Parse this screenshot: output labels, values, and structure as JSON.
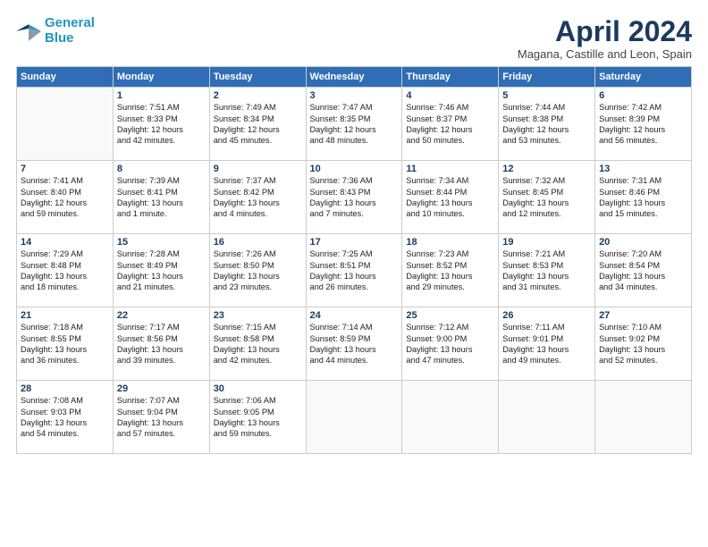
{
  "header": {
    "logo_line1": "General",
    "logo_line2": "Blue",
    "month": "April 2024",
    "location": "Magana, Castille and Leon, Spain"
  },
  "days_of_week": [
    "Sunday",
    "Monday",
    "Tuesday",
    "Wednesday",
    "Thursday",
    "Friday",
    "Saturday"
  ],
  "weeks": [
    [
      {
        "day": "",
        "sunrise": "",
        "sunset": "",
        "daylight": ""
      },
      {
        "day": "1",
        "sunrise": "Sunrise: 7:51 AM",
        "sunset": "Sunset: 8:33 PM",
        "daylight": "Daylight: 12 hours and 42 minutes."
      },
      {
        "day": "2",
        "sunrise": "Sunrise: 7:49 AM",
        "sunset": "Sunset: 8:34 PM",
        "daylight": "Daylight: 12 hours and 45 minutes."
      },
      {
        "day": "3",
        "sunrise": "Sunrise: 7:47 AM",
        "sunset": "Sunset: 8:35 PM",
        "daylight": "Daylight: 12 hours and 48 minutes."
      },
      {
        "day": "4",
        "sunrise": "Sunrise: 7:46 AM",
        "sunset": "Sunset: 8:37 PM",
        "daylight": "Daylight: 12 hours and 50 minutes."
      },
      {
        "day": "5",
        "sunrise": "Sunrise: 7:44 AM",
        "sunset": "Sunset: 8:38 PM",
        "daylight": "Daylight: 12 hours and 53 minutes."
      },
      {
        "day": "6",
        "sunrise": "Sunrise: 7:42 AM",
        "sunset": "Sunset: 8:39 PM",
        "daylight": "Daylight: 12 hours and 56 minutes."
      }
    ],
    [
      {
        "day": "7",
        "sunrise": "Sunrise: 7:41 AM",
        "sunset": "Sunset: 8:40 PM",
        "daylight": "Daylight: 12 hours and 59 minutes."
      },
      {
        "day": "8",
        "sunrise": "Sunrise: 7:39 AM",
        "sunset": "Sunset: 8:41 PM",
        "daylight": "Daylight: 13 hours and 1 minute."
      },
      {
        "day": "9",
        "sunrise": "Sunrise: 7:37 AM",
        "sunset": "Sunset: 8:42 PM",
        "daylight": "Daylight: 13 hours and 4 minutes."
      },
      {
        "day": "10",
        "sunrise": "Sunrise: 7:36 AM",
        "sunset": "Sunset: 8:43 PM",
        "daylight": "Daylight: 13 hours and 7 minutes."
      },
      {
        "day": "11",
        "sunrise": "Sunrise: 7:34 AM",
        "sunset": "Sunset: 8:44 PM",
        "daylight": "Daylight: 13 hours and 10 minutes."
      },
      {
        "day": "12",
        "sunrise": "Sunrise: 7:32 AM",
        "sunset": "Sunset: 8:45 PM",
        "daylight": "Daylight: 13 hours and 12 minutes."
      },
      {
        "day": "13",
        "sunrise": "Sunrise: 7:31 AM",
        "sunset": "Sunset: 8:46 PM",
        "daylight": "Daylight: 13 hours and 15 minutes."
      }
    ],
    [
      {
        "day": "14",
        "sunrise": "Sunrise: 7:29 AM",
        "sunset": "Sunset: 8:48 PM",
        "daylight": "Daylight: 13 hours and 18 minutes."
      },
      {
        "day": "15",
        "sunrise": "Sunrise: 7:28 AM",
        "sunset": "Sunset: 8:49 PM",
        "daylight": "Daylight: 13 hours and 21 minutes."
      },
      {
        "day": "16",
        "sunrise": "Sunrise: 7:26 AM",
        "sunset": "Sunset: 8:50 PM",
        "daylight": "Daylight: 13 hours and 23 minutes."
      },
      {
        "day": "17",
        "sunrise": "Sunrise: 7:25 AM",
        "sunset": "Sunset: 8:51 PM",
        "daylight": "Daylight: 13 hours and 26 minutes."
      },
      {
        "day": "18",
        "sunrise": "Sunrise: 7:23 AM",
        "sunset": "Sunset: 8:52 PM",
        "daylight": "Daylight: 13 hours and 29 minutes."
      },
      {
        "day": "19",
        "sunrise": "Sunrise: 7:21 AM",
        "sunset": "Sunset: 8:53 PM",
        "daylight": "Daylight: 13 hours and 31 minutes."
      },
      {
        "day": "20",
        "sunrise": "Sunrise: 7:20 AM",
        "sunset": "Sunset: 8:54 PM",
        "daylight": "Daylight: 13 hours and 34 minutes."
      }
    ],
    [
      {
        "day": "21",
        "sunrise": "Sunrise: 7:18 AM",
        "sunset": "Sunset: 8:55 PM",
        "daylight": "Daylight: 13 hours and 36 minutes."
      },
      {
        "day": "22",
        "sunrise": "Sunrise: 7:17 AM",
        "sunset": "Sunset: 8:56 PM",
        "daylight": "Daylight: 13 hours and 39 minutes."
      },
      {
        "day": "23",
        "sunrise": "Sunrise: 7:15 AM",
        "sunset": "Sunset: 8:58 PM",
        "daylight": "Daylight: 13 hours and 42 minutes."
      },
      {
        "day": "24",
        "sunrise": "Sunrise: 7:14 AM",
        "sunset": "Sunset: 8:59 PM",
        "daylight": "Daylight: 13 hours and 44 minutes."
      },
      {
        "day": "25",
        "sunrise": "Sunrise: 7:12 AM",
        "sunset": "Sunset: 9:00 PM",
        "daylight": "Daylight: 13 hours and 47 minutes."
      },
      {
        "day": "26",
        "sunrise": "Sunrise: 7:11 AM",
        "sunset": "Sunset: 9:01 PM",
        "daylight": "Daylight: 13 hours and 49 minutes."
      },
      {
        "day": "27",
        "sunrise": "Sunrise: 7:10 AM",
        "sunset": "Sunset: 9:02 PM",
        "daylight": "Daylight: 13 hours and 52 minutes."
      }
    ],
    [
      {
        "day": "28",
        "sunrise": "Sunrise: 7:08 AM",
        "sunset": "Sunset: 9:03 PM",
        "daylight": "Daylight: 13 hours and 54 minutes."
      },
      {
        "day": "29",
        "sunrise": "Sunrise: 7:07 AM",
        "sunset": "Sunset: 9:04 PM",
        "daylight": "Daylight: 13 hours and 57 minutes."
      },
      {
        "day": "30",
        "sunrise": "Sunrise: 7:06 AM",
        "sunset": "Sunset: 9:05 PM",
        "daylight": "Daylight: 13 hours and 59 minutes."
      },
      {
        "day": "",
        "sunrise": "",
        "sunset": "",
        "daylight": ""
      },
      {
        "day": "",
        "sunrise": "",
        "sunset": "",
        "daylight": ""
      },
      {
        "day": "",
        "sunrise": "",
        "sunset": "",
        "daylight": ""
      },
      {
        "day": "",
        "sunrise": "",
        "sunset": "",
        "daylight": ""
      }
    ]
  ]
}
